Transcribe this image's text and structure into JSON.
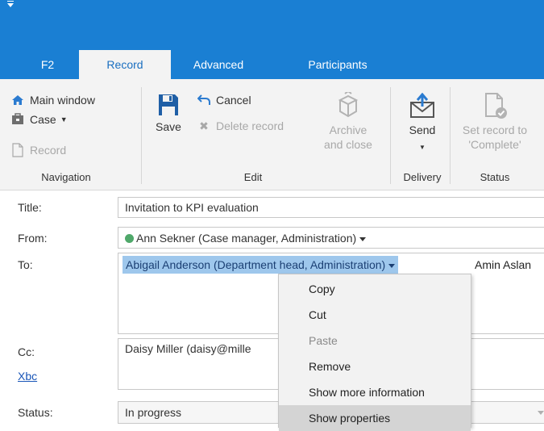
{
  "tabs": [
    {
      "label": "F2"
    },
    {
      "label": "Record"
    },
    {
      "label": "Advanced"
    },
    {
      "label": "Participants"
    }
  ],
  "ribbon": {
    "navigation": {
      "label": "Navigation",
      "main_window": "Main window",
      "case": "Case",
      "record": "Record"
    },
    "edit": {
      "label": "Edit",
      "save": "Save",
      "cancel": "Cancel",
      "delete_record": "Delete record",
      "archive_line1": "Archive",
      "archive_line2": "and close"
    },
    "delivery": {
      "label": "Delivery",
      "send": "Send"
    },
    "status": {
      "label": "Status",
      "set_line1": "Set record to",
      "set_line2": "'Complete'"
    }
  },
  "form": {
    "title_label": "Title:",
    "title_value": "Invitation to KPI evaluation",
    "from_label": "From:",
    "from_value": "Ann Sekner (Case manager, Administration)",
    "to_label": "To:",
    "to_selected": "Abigail Anderson (Department head, Administration)",
    "to_second": "Amin Aslan",
    "cc_label": "Cc:",
    "cc_value": "Daisy Miller (daisy@mille",
    "xbc_link": "Xbc",
    "status_label": "Status:",
    "status_value": "In progress"
  },
  "context_menu": {
    "items": [
      {
        "label": "Copy"
      },
      {
        "label": "Cut"
      },
      {
        "label": "Paste"
      },
      {
        "label": "Remove"
      },
      {
        "label": "Show more information"
      },
      {
        "label": "Show properties"
      }
    ]
  },
  "colors": {
    "accent": "#1a7fd3",
    "selection": "#9ec7ec",
    "presence_green": "#4fa86a"
  }
}
